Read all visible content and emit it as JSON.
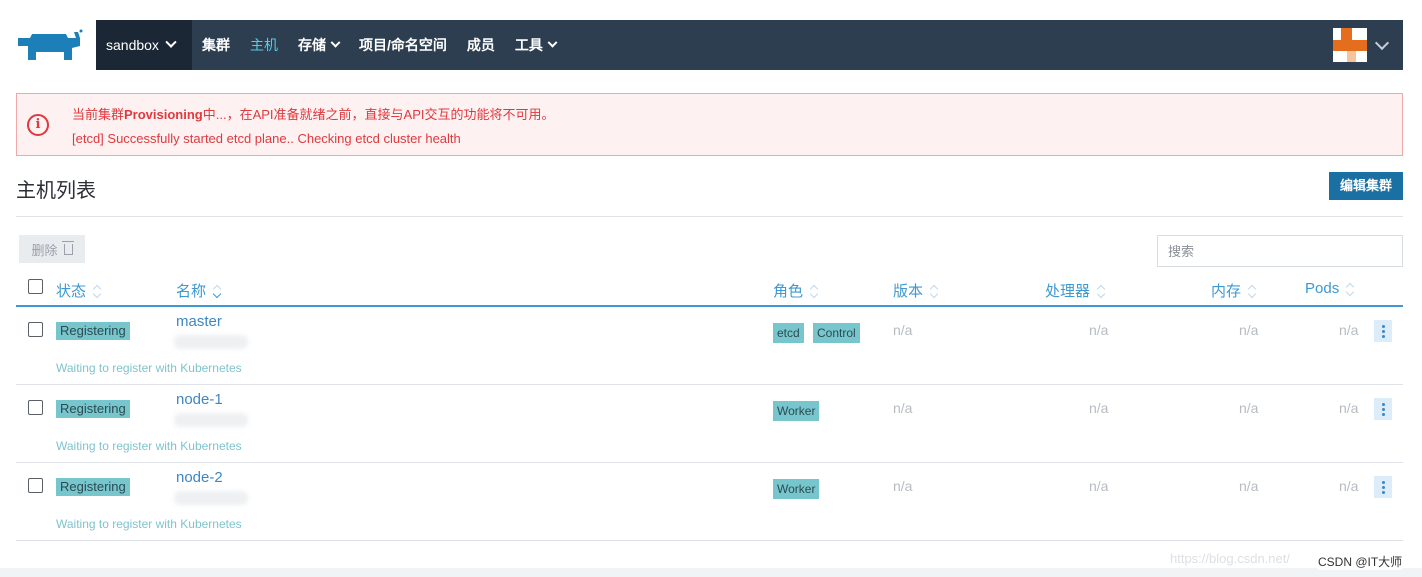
{
  "nav": {
    "cluster": "sandbox",
    "items": [
      {
        "label": "集群",
        "dropdown": false,
        "active": false
      },
      {
        "label": "主机",
        "dropdown": false,
        "active": true
      },
      {
        "label": "存储",
        "dropdown": true,
        "active": false
      },
      {
        "label": "项目/命名空间",
        "dropdown": false,
        "active": false
      },
      {
        "label": "成员",
        "dropdown": false,
        "active": false
      },
      {
        "label": "工具",
        "dropdown": true,
        "active": false
      }
    ],
    "accent": "#4ed1e8",
    "bar_color": "#2c3e50"
  },
  "alert": {
    "line1_prefix": "当前集群",
    "line1_bold": "Provisioning",
    "line1_suffix": "中...，在API准备就绪之前，直接与API交互的功能将不可用。",
    "line2": "[etcd] Successfully started etcd plane.. Checking etcd cluster health",
    "color": "#e0393e"
  },
  "page": {
    "title": "主机列表",
    "edit_button": "编辑集群",
    "delete_button": "删除",
    "search_placeholder": "搜索"
  },
  "table": {
    "columns": {
      "state": "状态",
      "name": "名称",
      "role": "角色",
      "version": "版本",
      "cpu": "处理器",
      "memory": "内存",
      "pods": "Pods"
    },
    "rows": [
      {
        "state": "Registering",
        "name": "master",
        "roles": [
          "etcd",
          "Control"
        ],
        "version": "n/a",
        "cpu": "n/a",
        "memory": "n/a",
        "pods": "n/a",
        "hint": "Waiting to register with Kubernetes"
      },
      {
        "state": "Registering",
        "name": "node-1",
        "roles": [
          "Worker"
        ],
        "version": "n/a",
        "cpu": "n/a",
        "memory": "n/a",
        "pods": "n/a",
        "hint": "Waiting to register with Kubernetes"
      },
      {
        "state": "Registering",
        "name": "node-2",
        "roles": [
          "Worker"
        ],
        "version": "n/a",
        "cpu": "n/a",
        "memory": "n/a",
        "pods": "n/a",
        "hint": "Waiting to register with Kubernetes"
      }
    ]
  },
  "watermark": "https://blog.csdn.net/",
  "csdn_tag": "CSDN @IT大师"
}
